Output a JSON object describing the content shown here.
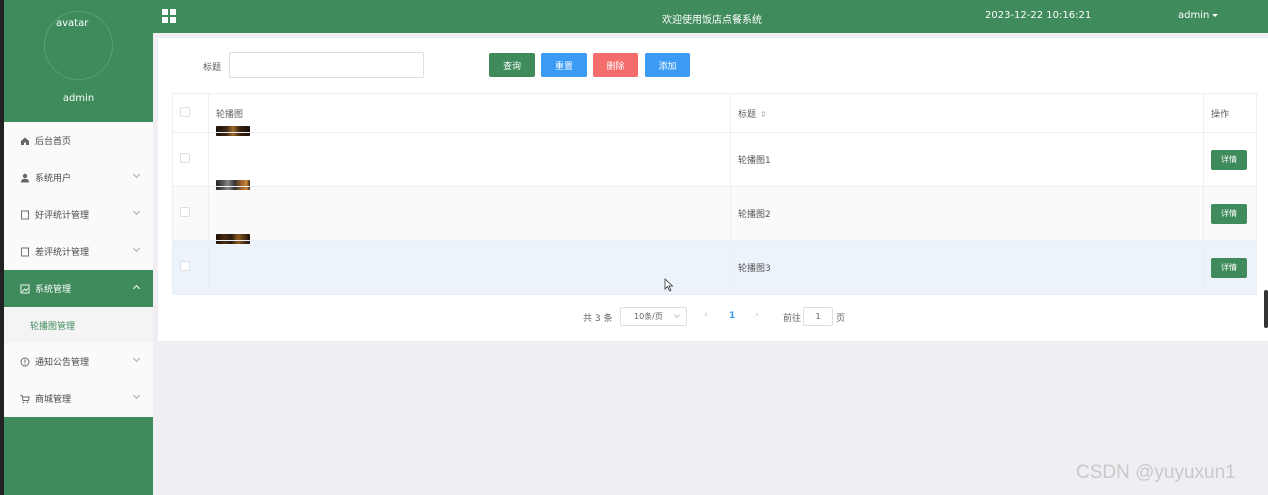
{
  "sidebar": {
    "avatar_alt": "avatar",
    "username": "admin",
    "items": [
      {
        "label": "后台首页",
        "icon": "home-icon"
      },
      {
        "label": "系统用户",
        "icon": "user-icon"
      },
      {
        "label": "好评统计管理",
        "icon": "document-icon"
      },
      {
        "label": "差评统计管理",
        "icon": "document-icon"
      },
      {
        "label": "系统管理",
        "icon": "image-icon"
      },
      {
        "label": "通知公告管理",
        "icon": "info-icon"
      },
      {
        "label": "商城管理",
        "icon": "cart-icon"
      }
    ],
    "subitem": "轮播图管理"
  },
  "header": {
    "title": "欢迎使用饭店点餐系统",
    "datetime": "2023-12-22 10:16:21",
    "user": "admin"
  },
  "search": {
    "label": "标题",
    "value": "",
    "buttons": {
      "query": "查询",
      "reset": "重置",
      "delete": "删除",
      "add": "添加"
    }
  },
  "table": {
    "columns": [
      "轮播图",
      "标题",
      "操作"
    ],
    "rows": [
      {
        "title": "轮播图1",
        "action": "详情"
      },
      {
        "title": "轮播图2",
        "action": "详情"
      },
      {
        "title": "轮播图3",
        "action": "详情"
      }
    ]
  },
  "pagination": {
    "total": "共 3 条",
    "page_size": "10条/页",
    "current": "1",
    "goto_label": "前往",
    "goto_value": "1",
    "page_unit": "页"
  },
  "watermark": "CSDN @yuyuxun1",
  "colors": {
    "primary": "#3f8b5c",
    "blue": "#3b9bf4",
    "danger": "#f56c6c"
  }
}
